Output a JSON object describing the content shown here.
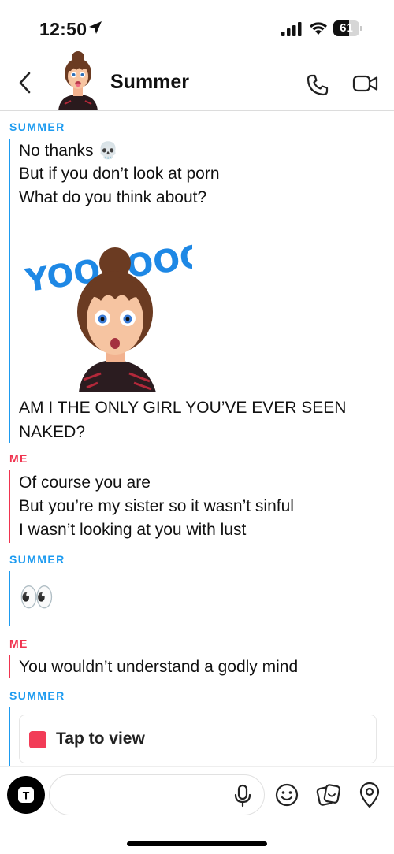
{
  "status_bar": {
    "time": "12:50",
    "battery": "61",
    "battery_level": 0.61
  },
  "header": {
    "contact_name": "Summer",
    "back_icon": "chevron-left-icon",
    "call_icon": "phone-icon",
    "video_icon": "video-camera-icon"
  },
  "messages": [
    {
      "sender": "SUMMER",
      "lines": [
        "No thanks 💀",
        "But if you don’t look at porn",
        "What do you think about?"
      ]
    },
    {
      "sender": "SUMMER",
      "sticker_text": "YOOOOOOOOO",
      "lines": [
        "AM I THE ONLY GIRL YOU’VE EVER SEEN",
        "NAKED?"
      ]
    },
    {
      "sender": "ME",
      "lines": [
        "Of course you are",
        "But you’re my sister so it wasn’t sinful",
        "I wasn’t looking at you with lust"
      ]
    },
    {
      "sender": "SUMMER",
      "lines": [
        "👀"
      ]
    },
    {
      "sender": "ME",
      "lines": [
        "You wouldn’t understand a godly mind"
      ]
    },
    {
      "sender": "SUMMER",
      "tap_text": "Tap to view"
    }
  ],
  "composer": {
    "placeholder": "",
    "camera_label": "T",
    "icons": [
      "camera-icon",
      "microphone-icon",
      "emoji-icon",
      "sticker-icon",
      "location-pin-icon"
    ]
  },
  "colors": {
    "summer": "#1d9bf0",
    "me": "#f0334f",
    "snap_red": "#f23c57"
  }
}
